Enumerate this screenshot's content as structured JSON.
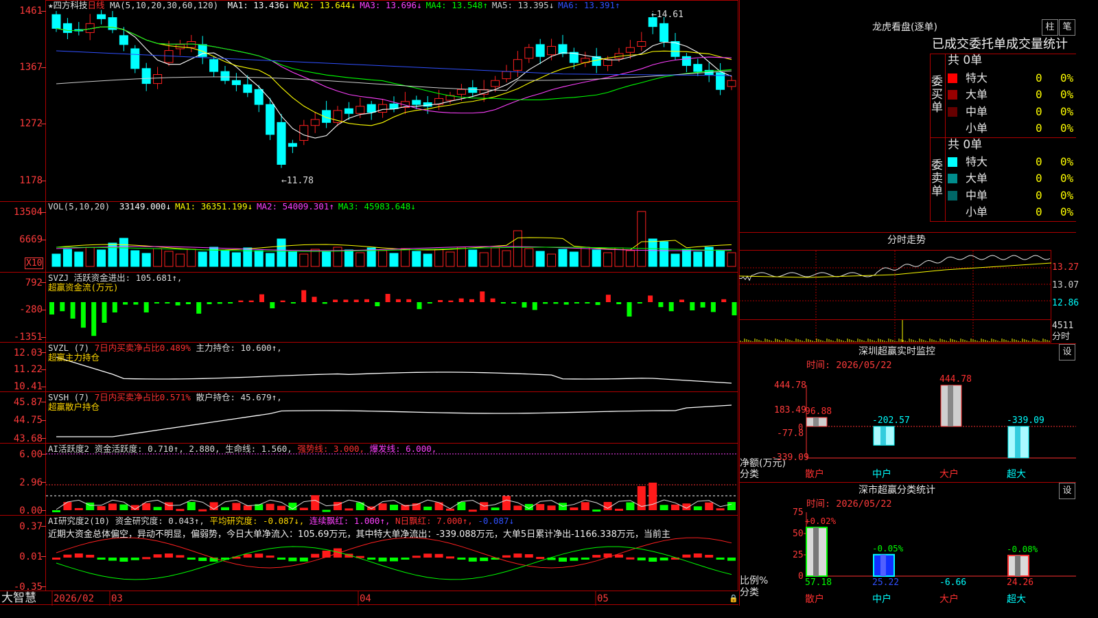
{
  "header": {
    "star": "★",
    "stock_name": "四方科技",
    "period": "日线",
    "ma_label": "MA(5,10,20,30,60,120)",
    "ma_items": [
      {
        "text": "MA1: 13.436↓",
        "color": "#ffffff"
      },
      {
        "text": "MA2: 13.644↓",
        "color": "#ffff00"
      },
      {
        "text": "MA3: 13.696↓",
        "color": "#ff40ff"
      },
      {
        "text": "MA4: 13.548↑",
        "color": "#00ff00"
      },
      {
        "text": "MA5: 13.395↓",
        "color": "#d0d0d0"
      },
      {
        "text": "MA6: 13.391↑",
        "color": "#3050ff"
      }
    ]
  },
  "price_axis": [
    "1461",
    "1367",
    "1272",
    "1178"
  ],
  "price_annotations": {
    "high": "14.61",
    "low": "11.78"
  },
  "volume": {
    "axis": [
      "13504",
      "6669"
    ],
    "multiplier": "X10",
    "label": "VOL(5,10,20)",
    "items": [
      {
        "text": "33149.000↓",
        "color": "#ffffff"
      },
      {
        "text": "MA1: 36351.199↓",
        "color": "#ffff00"
      },
      {
        "text": "MA2: 54009.301↑",
        "color": "#ff40ff"
      },
      {
        "text": "MA3: 45983.648↓",
        "color": "#00ff00"
      }
    ]
  },
  "svzj": {
    "axis": [
      "792",
      "-280",
      "-1351"
    ],
    "label": "SVZJ",
    "line1": "活跃资金进出: 105.681↑,",
    "line2": "超赢资金流(万元)",
    "values": [
      -3,
      -2.2,
      -4,
      -6.2,
      -8.2,
      -5,
      -2.5,
      -0.6,
      -0.6,
      -2.5,
      -0.3,
      -0.3,
      -0.8,
      -0.5,
      -2.8,
      -0.5,
      -0.4,
      -0.2,
      0.4,
      0.4,
      1.9,
      -1.5,
      0.4,
      -0.3,
      2.9,
      1.3,
      -0.4,
      0.6,
      0.6,
      0.6,
      0.7,
      -1.0,
      2.0,
      0.7,
      0.7,
      -1.7,
      -0.3,
      0.5,
      0.4,
      0.9,
      0.7,
      2.6,
      0.9,
      -0.3,
      -0.3,
      -1.3,
      -1.9,
      -0.4,
      -0.4,
      -0.6,
      -0.3,
      -0.3,
      -0.7,
      1.8,
      -0.5,
      -3.5,
      -0.3,
      1.6,
      -1.2,
      -2.2,
      0.6,
      -2.0,
      -1.3,
      -2.4,
      0.7,
      -3.2,
      0.4
    ]
  },
  "svzl": {
    "axis": [
      "12.03",
      "11.22",
      "10.41"
    ],
    "label": "SVZL (7)",
    "item1": "7日内买卖净占比0.489%",
    "item2": "主力持仓: 10.600↑,",
    "line2": "超赢主力持仓"
  },
  "svsh": {
    "axis": [
      "45.87",
      "44.75",
      "43.68"
    ],
    "label": "SVSH (7)",
    "item1": "7日内买卖净占比0.571%",
    "item2": "散户持仓: 45.679↑,",
    "line2": "超赢散户持仓"
  },
  "ai_active": {
    "axis": [
      "6.00",
      "2.96",
      "0.00"
    ],
    "label": "AI活跃度2",
    "item1": "资金活跃度: 0.710↑,",
    "item2": "2.880,",
    "item3": "生命线: 1.560,",
    "item4": "强势线: 3.000,",
    "item5": "爆发线: 6.000,"
  },
  "ai_research": {
    "axis": [
      "0.37",
      "0.01",
      "-0.35"
    ],
    "label": "AI研究度2(10)",
    "item1": "资金研究度: 0.043↑,",
    "item2": "平均研究度: -0.087↓,",
    "item3": "连续飘红: 1.000↑,",
    "item4": "N日飘红: 7.000↑,",
    "item5": "-0.087↓",
    "summary": "近期大资金总体偏空，异动不明显，偏弱势，今日大单净流入：105.69万元，其中特大单净流出：-339.088万元，大单5日累计净出-1166.338万元，当前主"
  },
  "bottom_bar": {
    "brand": "大智慧",
    "date": "2026/02",
    "m3": "03",
    "m4": "04",
    "m5": "05"
  },
  "right_panel": {
    "dragon_title": "龙虎看盘(逐单)",
    "btn_bar": "柱",
    "btn_bi": "笔",
    "stats_title": "已成交委托单成交量统计",
    "buy_side": "委买单",
    "sell_side": "委卖单",
    "buy_total": "共 0单",
    "sell_total": "共 0单",
    "buy_rows": [
      {
        "name": "特大",
        "count": "0",
        "pct": "0%",
        "color": "#ff0000"
      },
      {
        "name": "大单",
        "count": "0",
        "pct": "0%",
        "color": "#990000"
      },
      {
        "name": "中单",
        "count": "0",
        "pct": "0%",
        "color": "#660000"
      },
      {
        "name": "小单",
        "count": "0",
        "pct": "0%",
        "color": "#000000"
      }
    ],
    "sell_rows": [
      {
        "name": "特大",
        "count": "0",
        "pct": "0%",
        "color": "#00ffff"
      },
      {
        "name": "大单",
        "count": "0",
        "pct": "0%",
        "color": "#008c8c"
      },
      {
        "name": "中单",
        "count": "0",
        "pct": "0%",
        "color": "#006666"
      },
      {
        "name": "小单",
        "count": "0",
        "pct": "0%",
        "color": "#000000"
      }
    ],
    "intraday_title": "分时走势",
    "intraday_axis": [
      "13.27",
      "13.07",
      "12.86"
    ],
    "intraday_vol": "4511",
    "intraday_unit": "分时",
    "sz_monitor_title": "深圳超赢实时监控",
    "sz_monitor_time": "时间: 2026/05/22",
    "sz_monitor_gear": "设",
    "sz_monitor_axis": [
      "444.78",
      "183.49",
      "-77.8",
      "-339.09"
    ],
    "sz_monitor_axis_zero": "0",
    "sz_monitor_ylabel": "净额(万元)",
    "sz_monitor_xlabel": "分类",
    "sz_monitor": [
      {
        "label": "散户",
        "value": 96.88,
        "text": "96.88"
      },
      {
        "label": "中户",
        "value": -202.57,
        "text": "-202.57"
      },
      {
        "label": "大户",
        "value": 444.78,
        "text": "444.78"
      },
      {
        "label": "超大",
        "value": -339.09,
        "text": "-339.09"
      }
    ],
    "sz_class_title": "深市超赢分类统计",
    "sz_class_time": "时间: 2026/05/22",
    "sz_class_gear": "设",
    "sz_class_axis": [
      "75",
      "50",
      "25",
      "0"
    ],
    "sz_class_ylabel": "比例%",
    "sz_class_xlabel": "分类",
    "sz_class": [
      {
        "label": "散户",
        "top": "+0.02%",
        "bottom": "57.18",
        "pct": 57.18
      },
      {
        "label": "中户",
        "top": "-0.05%",
        "bottom": "25.22",
        "pct": 25.22
      },
      {
        "label": "大户",
        "top": "",
        "bottom": "-6.66",
        "pct": 0
      },
      {
        "label": "超大",
        "top": "-0.08%",
        "bottom": "24.26",
        "pct": 24.26
      }
    ]
  },
  "colors": {
    "up": "#ff2020",
    "down": "#00ffff",
    "grid": "#b00000",
    "ma1": "#ffffff",
    "ma2": "#ffff00",
    "ma3": "#ff40ff",
    "ma4": "#00ff00",
    "ma5": "#d0d0d0",
    "ma6": "#3050ff"
  }
}
